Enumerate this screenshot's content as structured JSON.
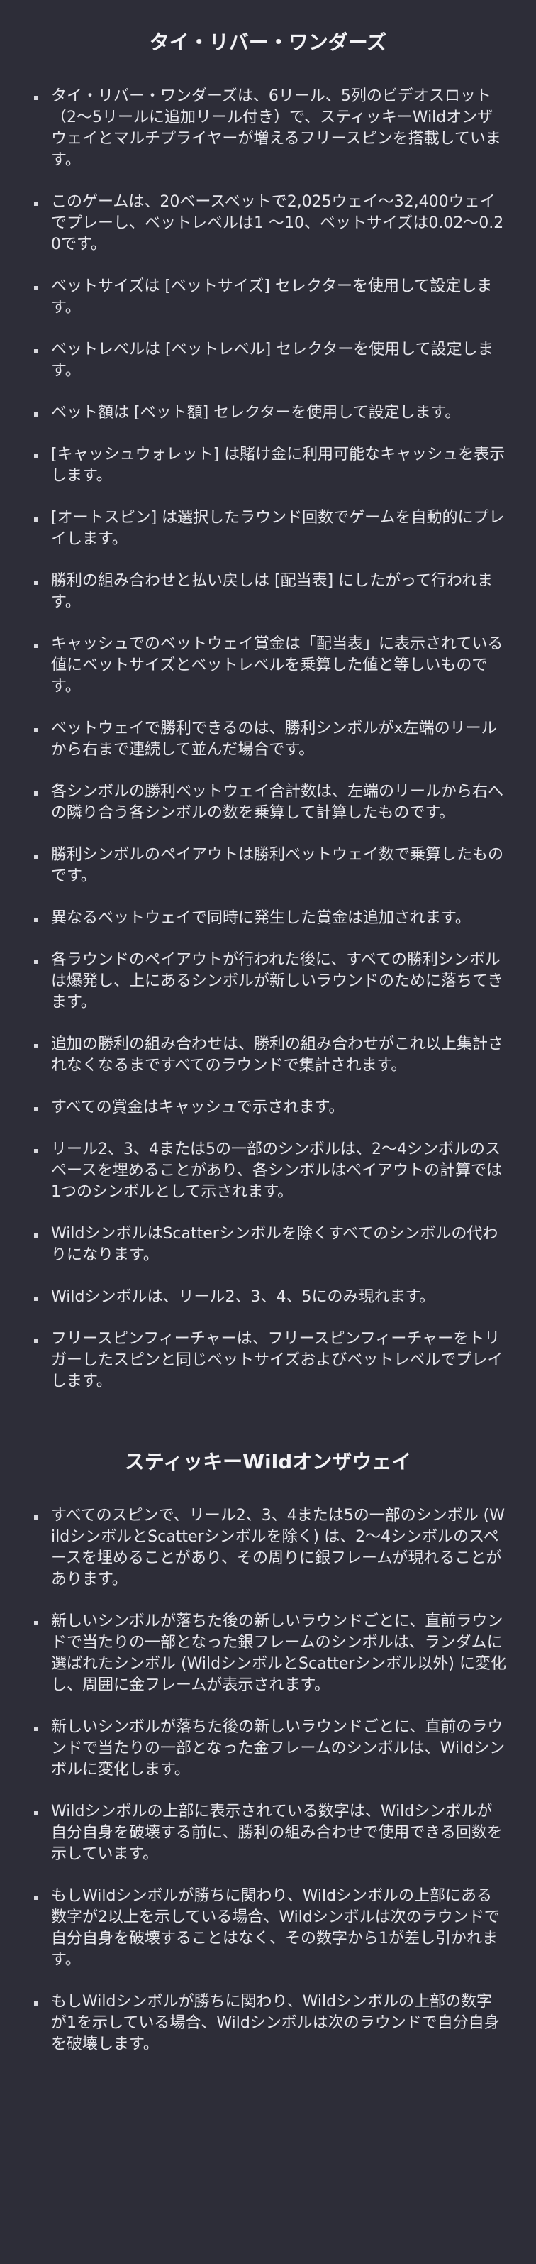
{
  "sections": [
    {
      "title": "タイ・リバー・ワンダーズ",
      "items": [
        "タイ・リバー・ワンダーズは、6リール、5列のビデオスロット（2～5リールに追加リール付き）で、スティッキーWildオンザウェイとマルチプライヤーが増えるフリースピンを搭載しています。",
        "このゲームは、20ベースベットで2,025ウェイ～32,400ウェイでプレーし、ベットレベルは1 ～10、ベットサイズは0.02～0.20です。",
        "ベットサイズは [ベットサイズ] セレクターを使用して設定します。",
        "ベットレベルは [ベットレベル] セレクターを使用して設定します。",
        "ベット額は [ベット額] セレクターを使用して設定します。",
        "[キャッシュウォレット] は賭け金に利用可能なキャッシュを表示します。",
        "[オートスピン] は選択したラウンド回数でゲームを自動的にプレイします。",
        "勝利の組み合わせと払い戻しは [配当表] にしたがって行われます。",
        "キャッシュでのベットウェイ賞金は「配当表」に表示されている値にベットサイズとベットレベルを乗算した値と等しいものです。",
        "ベットウェイで勝利できるのは、勝利シンボルがx左端のリールから右まで連続して並んだ場合です。",
        "各シンボルの勝利ベットウェイ合計数は、左端のリールから右への隣り合う各シンボルの数を乗算して計算したものです。",
        "勝利シンボルのペイアウトは勝利ベットウェイ数で乗算したものです。",
        "異なるベットウェイで同時に発生した賞金は追加されます。",
        "各ラウンドのペイアウトが行われた後に、すべての勝利シンボルは爆発し、上にあるシンボルが新しいラウンドのために落ちてきます。",
        "追加の勝利の組み合わせは、勝利の組み合わせがこれ以上集計されなくなるまですべてのラウンドで集計されます。",
        "すべての賞金はキャッシュで示されます。",
        "リール2、3、4または5の一部のシンボルは、2～4シンボルのスペースを埋めることがあり、各シンボルはペイアウトの計算では1つのシンボルとして示されます。",
        "WildシンボルはScatterシンボルを除くすべてのシンボルの代わりになります。",
        "Wildシンボルは、リール2、3、4、5にのみ現れます。",
        "フリースピンフィーチャーは、フリースピンフィーチャーをトリガーしたスピンと同じベットサイズおよびベットレベルでプレイします。"
      ]
    },
    {
      "title": "スティッキーWildオンザウェイ",
      "items": [
        "すべてのスピンで、リール2、3、4または5の一部のシンボル (WildシンボルとScatterシンボルを除く) は、2～4シンボルのスペースを埋めることがあり、その周りに銀フレームが現れることがあります。",
        "新しいシンボルが落ちた後の新しいラウンドごとに、直前ラウンドで当たりの一部となった銀フレームのシンボルは、ランダムに選ばれたシンボル (WildシンボルとScatterシンボル以外) に変化し、周囲に金フレームが表示されます。",
        "新しいシンボルが落ちた後の新しいラウンドごとに、直前のラウンドで当たりの一部となった金フレームのシンボルは、Wildシンボルに変化します。",
        "Wildシンボルの上部に表示されている数字は、Wildシンボルが自分自身を破壊する前に、勝利の組み合わせで使用できる回数を示しています。",
        "もしWildシンボルが勝ちに関わり、Wildシンボルの上部にある数字が2以上を示している場合、Wildシンボルは次のラウンドで自分自身を破壊することはなく、その数字から1が差し引かれます。",
        "もしWildシンボルが勝ちに関わり、Wildシンボルの上部の数字が1を示している場合、Wildシンボルは次のラウンドで自分自身を破壊します。"
      ]
    }
  ]
}
